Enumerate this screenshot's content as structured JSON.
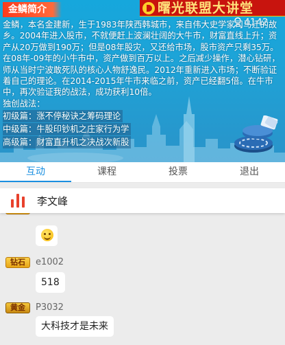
{
  "banner": {
    "title": "金鳞简介",
    "brand_name": "曙光联盟大讲堂",
    "viewer_count": "4142",
    "paragraphs": [
      "金鳞，本名金建新，生于1983年陕西韩城市，来自伟大史学家司马迁的故乡。2004年进入股市，不就便赶上波澜壮阔的大牛市，财富直线上升；资产从20万做到190万；但是08年股灾，又还给市场，股市资产只剩35万。在08年-09年的小牛市中，资产做到百万以上。之后减少操作，潜心钻研，师从当时宁波敢死队的核心人物舒逸民。2012年重新进入市场；不断验证着自己的理论。在2014-2015年牛市来临之前，资产已经翻5倍。在牛市中，再次验证我的战法，成功获利10倍。",
      "独创战法："
    ],
    "courses": [
      "初级篇：涨不停秘诀之筹码理论",
      "中级篇：牛股印钞机之庄家行为学",
      "高级篇：财富直升机之决战次新股"
    ]
  },
  "tabs": [
    {
      "label": "互动",
      "active": true
    },
    {
      "label": "课程",
      "active": false
    },
    {
      "label": "投票",
      "active": false
    },
    {
      "label": "退出",
      "active": false
    }
  ],
  "teacher": {
    "name": "李文峰",
    "icon": "signal-bars-icon",
    "color": "#e8412c"
  },
  "messages": [
    {
      "badge": "钻石",
      "user": "e1002",
      "content": "",
      "emoji": "smile-emoji"
    },
    {
      "badge": "钻石",
      "user": "e1002",
      "content": "",
      "emoji": "smile-emoji"
    },
    {
      "badge": "钻石",
      "user": "e1002",
      "content": "518"
    },
    {
      "badge": "黄金",
      "user": "P3032",
      "content": "大科技才是未来"
    }
  ],
  "colors": {
    "accent": "#1a8fe0",
    "banner_blue": "#1ea3d7",
    "title_orange": "#fc3b1d",
    "brand_red": "#c8140e"
  }
}
